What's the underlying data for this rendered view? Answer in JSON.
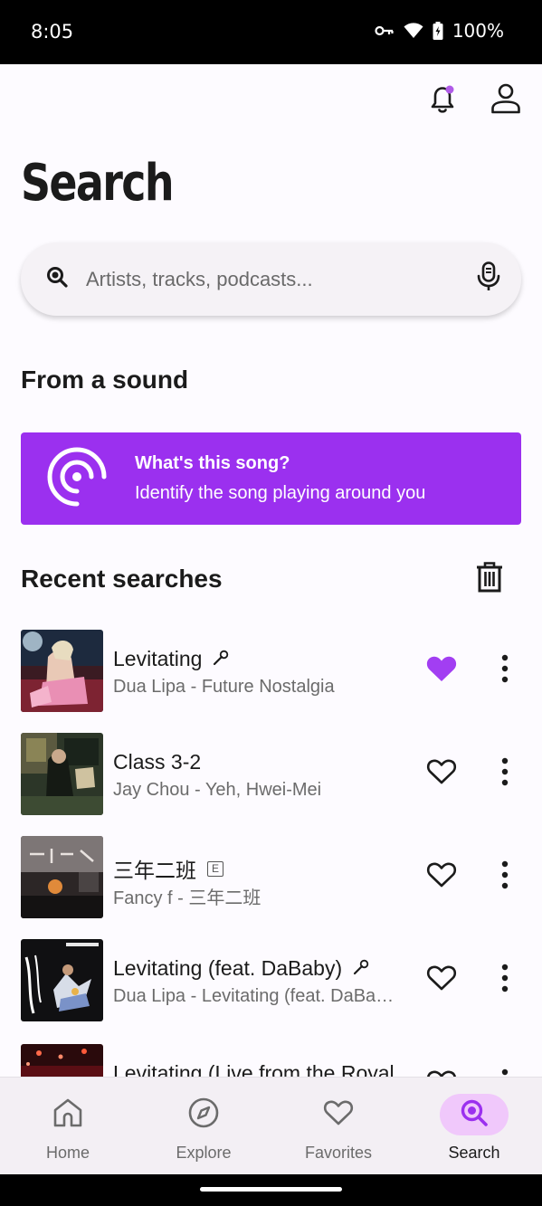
{
  "status_bar": {
    "time": "8:05",
    "battery": "100%"
  },
  "header": {
    "title": "Search"
  },
  "search": {
    "placeholder": "Artists, tracks, podcasts..."
  },
  "from_sound": {
    "section_title": "From a sound",
    "card_title": "What's this song?",
    "card_subtitle": "Identify the song playing around you"
  },
  "recent": {
    "section_title": "Recent searches",
    "items": [
      {
        "title": "Levitating",
        "subtitle": "Dua Lipa - Future Nostalgia",
        "badge": "mic",
        "favorited": true
      },
      {
        "title": "Class 3-2",
        "subtitle": "Jay Chou - Yeh, Hwei-Mei",
        "badge": "",
        "favorited": false
      },
      {
        "title": "三年二班",
        "subtitle": "Fancy f - 三年二班",
        "badge": "explicit",
        "badge_text": "E",
        "favorited": false
      },
      {
        "title": "Levitating (feat. DaBaby)",
        "subtitle": "Dua Lipa - Levitating (feat. DaBab…",
        "badge": "mic",
        "favorited": false
      },
      {
        "title": "Levitating (Live from the Royal",
        "subtitle": "",
        "badge": "",
        "favorited": false
      }
    ]
  },
  "nav": {
    "items": [
      {
        "label": "Home",
        "icon": "home-icon"
      },
      {
        "label": "Explore",
        "icon": "compass-icon"
      },
      {
        "label": "Favorites",
        "icon": "heart-icon"
      },
      {
        "label": "Search",
        "icon": "search-icon",
        "active": true
      }
    ]
  },
  "colors": {
    "accent": "#9b30ef",
    "active_pill": "#f0c8fb",
    "background": "#fdfbff"
  }
}
